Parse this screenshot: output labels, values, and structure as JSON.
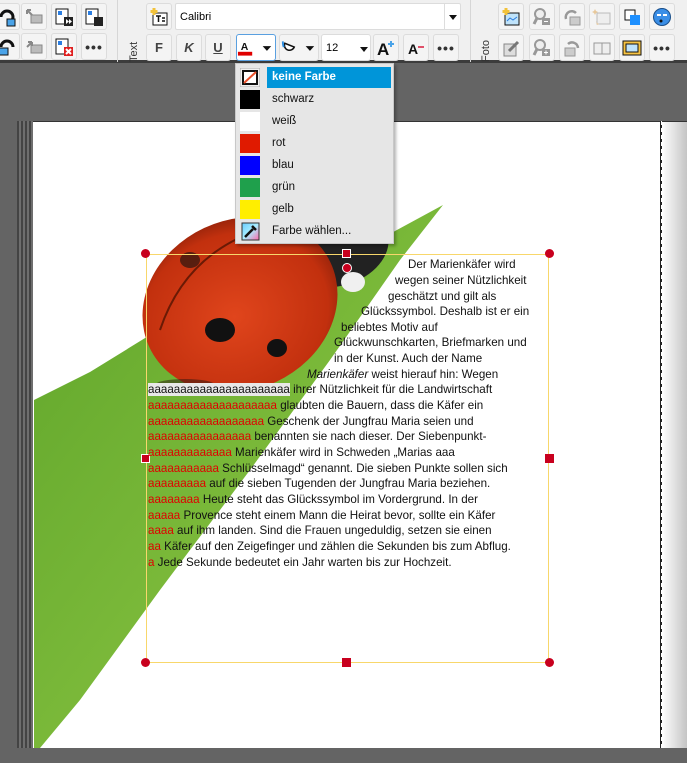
{
  "toolbar": {
    "text_group_label": "Text",
    "photo_group_label": "Foto",
    "font_name": "Calibri",
    "font_size": "12",
    "bold_label": "F",
    "italic_label": "K",
    "underline_label": "U",
    "more_label": "•••",
    "font_color": "#e00000"
  },
  "color_menu": {
    "items": [
      {
        "label": "keine Farbe",
        "color": "none",
        "selected": true
      },
      {
        "label": "schwarz",
        "color": "#000000"
      },
      {
        "label": "weiß",
        "color": "#ffffff"
      },
      {
        "label": "rot",
        "color": "#e01a00"
      },
      {
        "label": "blau",
        "color": "#0000ff"
      },
      {
        "label": "grün",
        "color": "#1fa04c"
      },
      {
        "label": "gelb",
        "color": "#ffee00"
      },
      {
        "label": "Farbe wählen...",
        "color": "picker"
      }
    ]
  },
  "text_frame": {
    "lines": [
      {
        "pre": "",
        "text": "Der Marienkäfer wird"
      },
      {
        "pre": "",
        "text": "wegen seiner Nützlichkeit"
      },
      {
        "pre": "",
        "text": "geschätzt und gilt als"
      },
      {
        "pre": "",
        "text": "Glückssymbol. Deshalb ist er ein"
      },
      {
        "pre": "",
        "text": "beliebtes Motiv auf"
      },
      {
        "pre": "",
        "text": "Glückwunschkarten, Briefmarken und"
      },
      {
        "pre": "",
        "text": "in der Kunst. Auch der Name"
      },
      {
        "pre": "Marienkäfer",
        "text": " weist hierauf hin: Wegen"
      },
      {
        "pre": "aaaaaaaaaaaaaaaaaaaaaa",
        "text": " ihrer Nützlichkeit für die Landwirtschaft"
      },
      {
        "pre": "aaaaaaaaaaaaaaaaaaaa",
        "text": " glaubten die Bauern, dass die Käfer ein"
      },
      {
        "pre": "aaaaaaaaaaaaaaaaaa",
        "text": " Geschenk der Jungfrau Maria seien und"
      },
      {
        "pre": "aaaaaaaaaaaaaaaa",
        "text": " benannten sie nach dieser. Der Siebenpunkt-"
      },
      {
        "pre": "aaaaaaaaaaaaa",
        "text": " Marienkäfer wird in Schweden „Marias aaa"
      },
      {
        "pre": "aaaaaaaaaaa",
        "text": " Schlüsselmagd“ genannt. Die sieben Punkte sollen sich"
      },
      {
        "pre": "aaaaaaaaa",
        "text": " auf die sieben Tugenden der Jungfrau Maria beziehen."
      },
      {
        "pre": "aaaaaaaa",
        "text": " Heute steht das Glückssymbol im Vordergrund. In der"
      },
      {
        "pre": "aaaaa",
        "text": " Provence steht einem Mann die Heirat bevor, sollte ein Käfer"
      },
      {
        "pre": "aaaa",
        "text": " auf ihm landen. Sind die Frauen ungeduldig, setzen sie einen"
      },
      {
        "pre": "aa",
        "text": " Käfer auf den Zeigefinger und zählen die Sekunden bis zum Abflug."
      },
      {
        "pre": "a",
        "text": " Jede Sekunde bedeutet ein Jahr warten bis zur Hochzeit."
      }
    ]
  }
}
